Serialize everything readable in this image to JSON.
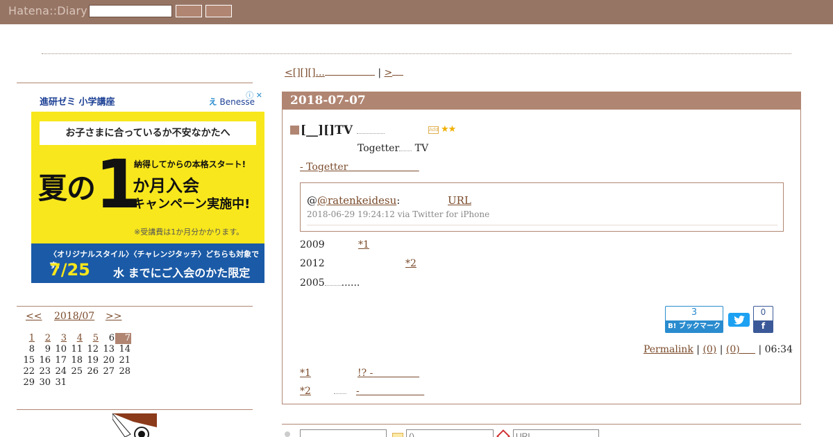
{
  "header": {
    "logo": "Hatena::Diary",
    "search_placeholder": ""
  },
  "ad": {
    "brand": "進研ゼミ 小学講座",
    "benesse": "Benesse",
    "info": "ⓘ ✕",
    "banner": "お子さまに合っているか不安なかたへ",
    "big_left": "夏の",
    "big_one": "1",
    "right1": "納得してからの本格スタート!",
    "right2": "か月入会",
    "right3": "キャンペーン実施中!",
    "right4": "※受講費は1か月分かかります。",
    "foot1": "〈オリジナルスタイル〉〈チャレンジタッチ〉どちらも対象です。",
    "foot2": "7/25",
    "foot2b": "水 までにご入会のかた限定"
  },
  "calendar": {
    "prev": "<<",
    "month": "2018/07",
    "next": ">>",
    "weeks": [
      [
        "1",
        "2",
        "3",
        "4",
        "5",
        "6",
        "7"
      ],
      [
        "8",
        "9",
        "10",
        "11",
        "12",
        "13",
        "14"
      ],
      [
        "15",
        "16",
        "17",
        "18",
        "19",
        "20",
        "21"
      ],
      [
        "22",
        "23",
        "24",
        "25",
        "26",
        "27",
        "28"
      ],
      [
        "29",
        "30",
        "31",
        "",
        "",
        "",
        ""
      ]
    ],
    "linked_days": [
      "1",
      "2",
      "3",
      "4",
      "5"
    ],
    "today": "7"
  },
  "pager": {
    "prev": "<[][][]...",
    "sep": "|",
    "next": ">"
  },
  "entry": {
    "date": "2018-07-07",
    "title": "[__][]TV",
    "star_add": "Add",
    "stars": "★★",
    "line1_a": "Togetter",
    "line1_b": "TV",
    "line2": "- Togetter",
    "tweet": {
      "user": "@ratenkeidesu",
      "colon": ":",
      "url": "URL",
      "meta": "2018-06-29 19:24:12 via Twitter for iPhone"
    },
    "p1": "2009",
    "p1_ref": "*1",
    "p2": "2012",
    "p2_ref": "*2",
    "p3_a": "2005",
    "p3_b": "......",
    "hatena_count": "3",
    "hatena_label": "B! ブックマーク",
    "twitter_label": "t",
    "fb_count": "0",
    "fb_label": "f",
    "footer": {
      "permalink": "Permalink",
      "comments": "(0)",
      "trackbacks": "(0)",
      "sep": "|",
      "time": "06:34"
    },
    "footnotes": [
      {
        "mark": "*1",
        "text": "!? -"
      },
      {
        "mark": "*2",
        "text": "-"
      }
    ]
  },
  "comment_form": {
    "mail_placeholder": "()",
    "url_placeholder": "URL"
  }
}
